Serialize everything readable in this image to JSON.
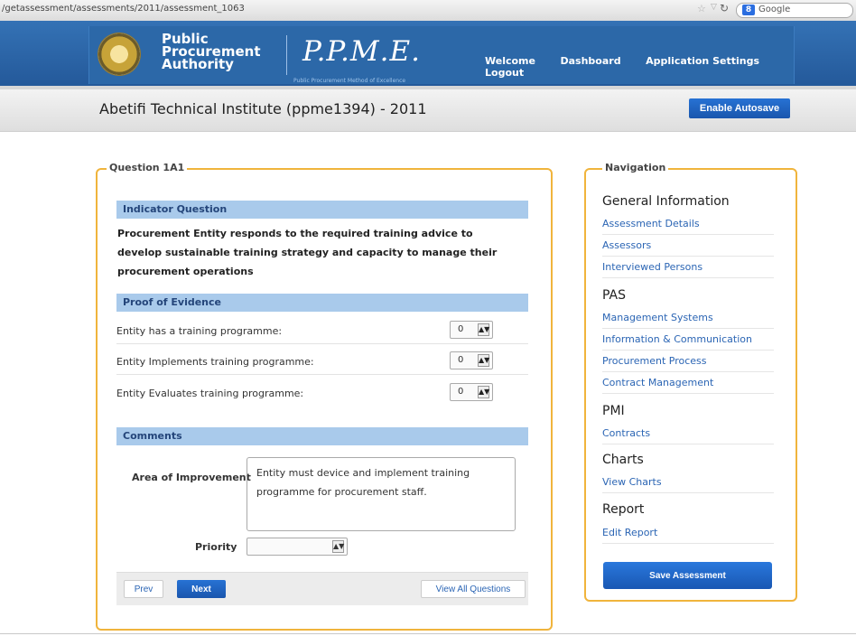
{
  "browser": {
    "url": "/getassessment/assessments/2011/assessment_1063",
    "search_engine_label": "Google",
    "search_engine_badge": "8"
  },
  "header": {
    "org_line1": "Public",
    "org_line2": "Procurement",
    "org_line3": "Authority",
    "brand": "P.P.M.E.",
    "brand_subtitle": "Public Procurement Method of Excellence",
    "nav": [
      "Welcome",
      "Dashboard",
      "Application Settings",
      "Logout"
    ]
  },
  "title_band": {
    "title": "Abetifi Technical Institute (ppme1394) - 2011",
    "autosave_label": "Enable Autosave"
  },
  "question": {
    "legend": "Question 1A1",
    "indicator_header": "Indicator Question",
    "indicator_text": "Procurement Entity responds to the required training advice to develop sustainable training strategy and capacity to manage their procurement operations",
    "evidence_header": "Proof of Evidence",
    "evidence": [
      {
        "label": "Entity has a training programme:",
        "value": "0"
      },
      {
        "label": "Entity Implements training programme:",
        "value": "0"
      },
      {
        "label": "Entity Evaluates training programme:",
        "value": "0"
      }
    ],
    "comments_header": "Comments",
    "area_label": "Area of Improvement",
    "area_value": "Entity must device and implement training programme for procurement staff.",
    "priority_label": "Priority",
    "priority_value": "",
    "prev_label": "Prev",
    "next_label": "Next",
    "view_all_label": "View All Questions"
  },
  "navigation": {
    "legend": "Navigation",
    "sections": [
      {
        "title": "General Information",
        "items": [
          "Assessment Details",
          "Assessors",
          "Interviewed Persons"
        ]
      },
      {
        "title": "PAS",
        "items": [
          "Management Systems",
          "Information & Communication",
          "Procurement Process",
          "Contract Management"
        ]
      },
      {
        "title": "PMI",
        "items": [
          "Contracts"
        ]
      },
      {
        "title": "Charts",
        "items": [
          "View Charts"
        ]
      },
      {
        "title": "Report",
        "items": [
          "Edit Report"
        ]
      }
    ],
    "save_label": "Save Assessment"
  },
  "colors": {
    "header_blue": "#2c68a8",
    "panel_border": "#f0b43c",
    "section_blue": "#a9caeb",
    "link_blue": "#2b65b4",
    "button_blue": "#1a56ad"
  }
}
